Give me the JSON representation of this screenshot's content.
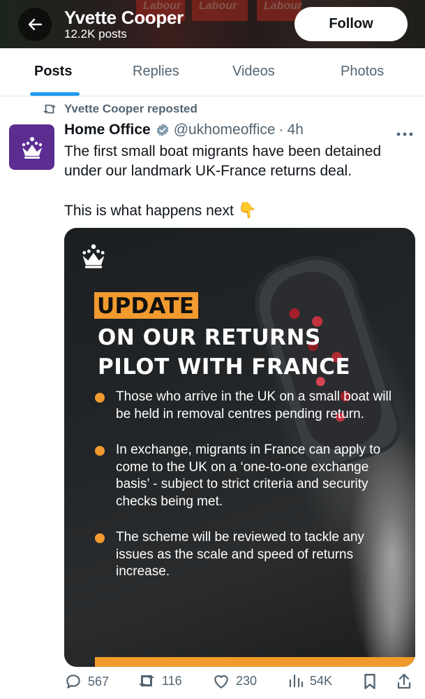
{
  "profile": {
    "name": "Yvette Cooper",
    "posts_count": "12.2K posts",
    "follow_label": "Follow",
    "banner_signs": [
      "Labour",
      "Labour",
      "Labour"
    ]
  },
  "tabs": [
    {
      "label": "Posts",
      "active": true
    },
    {
      "label": "Replies",
      "active": false
    },
    {
      "label": "Videos",
      "active": false
    },
    {
      "label": "Photos",
      "active": false
    }
  ],
  "post": {
    "repost_text": "Yvette Cooper reposted",
    "author": "Home Office",
    "verified": true,
    "handle": "@ukhomeoffice",
    "separator": "·",
    "time": "4h",
    "text_line1": "The first small boat migrants have been detained under our landmark UK-France returns deal.",
    "text_line2": "This is what happens next",
    "emoji": "👇",
    "media": {
      "tag": "UPDATE",
      "headline_line1": "ON OUR RETURNS",
      "headline_line2": "PILOT WITH FRANCE",
      "bullets": [
        "Those who arrive in the UK on a small boat will be held in removal centres pending return.",
        "In exchange, migrants in France can apply to come to the UK on a ‘one-to-one exchange basis’ - subject to strict criteria and security checks being met.",
        "The scheme will be reviewed to tackle any issues as the scale and speed of returns increase."
      ]
    },
    "stats": {
      "replies": "567",
      "reposts": "116",
      "likes": "230",
      "views": "54K"
    }
  },
  "colors": {
    "accent": "#1d9bf0",
    "avatar_bg": "#5b2d91",
    "orange": "#f29a2e",
    "muted_text": "#536471"
  },
  "icons": [
    "back-arrow-icon",
    "repost-icon",
    "crown-icon",
    "verified-badge-icon",
    "more-icon",
    "reply-icon",
    "retweet-icon",
    "like-icon",
    "views-icon",
    "bookmark-icon",
    "share-icon"
  ]
}
